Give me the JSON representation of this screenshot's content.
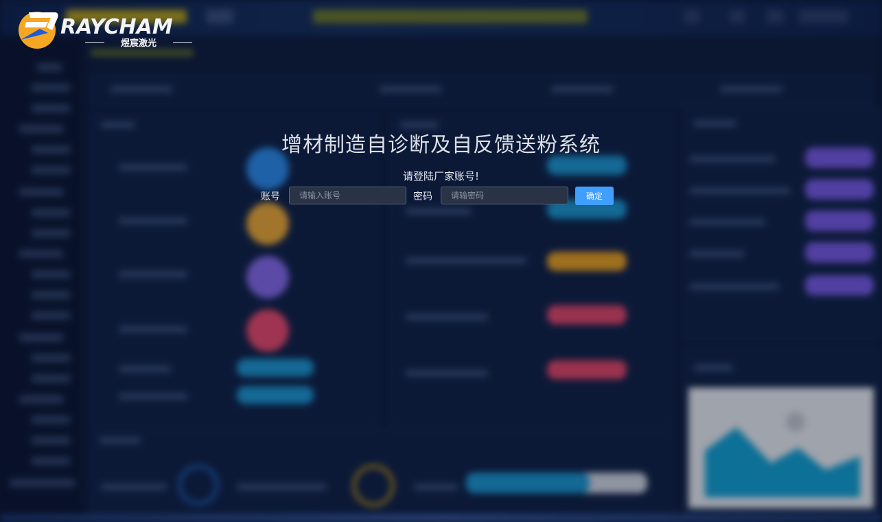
{
  "brand": {
    "name": "RAYCHAM",
    "subtitle": "煜宸激光"
  },
  "login": {
    "title": "增材制造自诊断及自反馈送粉系统",
    "prompt": "请登陆厂家账号!",
    "account_label": "账号",
    "account_placeholder": "请输入账号",
    "account_value": "",
    "password_label": "密码",
    "password_placeholder": "请输密码",
    "password_value": "",
    "confirm_label": "确定"
  },
  "colors": {
    "background": "#0b1733",
    "accent_button": "#409eff",
    "logo_orange": "#f5a623",
    "logo_blue": "#1e5bd8"
  }
}
